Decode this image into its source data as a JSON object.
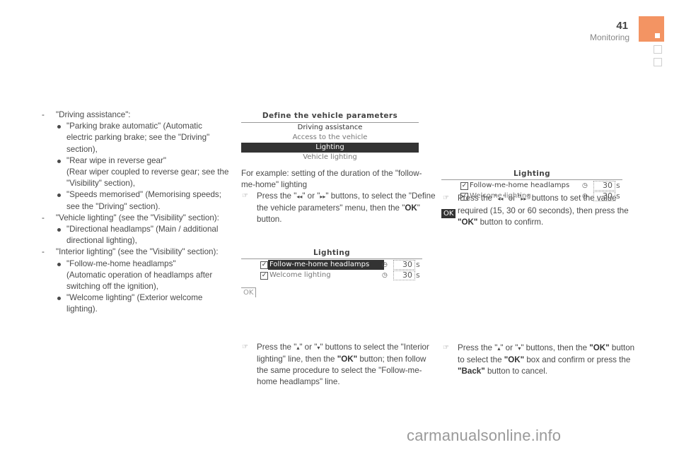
{
  "header": {
    "page_number": "41",
    "section": "Monitoring",
    "tab_color": "#f39463"
  },
  "column1": {
    "items": [
      {
        "marker": "-",
        "text": "\"Driving assistance\":",
        "bullets": [
          {
            "text": "\"Parking brake automatic\" (Automatic electric parking brake; see the \"Driving\" section),"
          },
          {
            "text": "\"Rear wipe in reverse gear\"",
            "sub": "(Rear wiper coupled to reverse gear; see the \"Visibility\" section),"
          },
          {
            "text": "\"Speeds memorised\" (Memorising speeds; see the \"Driving\" section)."
          }
        ]
      },
      {
        "marker": "-",
        "text": "\"Vehicle lighting\" (see the \"Visibility\" section):",
        "bullets": [
          {
            "text": "\"Directional headlamps\" (Main / additional directional lighting),"
          }
        ]
      },
      {
        "marker": "-",
        "text": "\"Interior lighting\" (see the \"Visibility\" section):",
        "bullets": [
          {
            "text": "\"Follow-me-home headlamps\"",
            "sub": "(Automatic operation of headlamps after switching off the ignition),"
          },
          {
            "text": "\"Welcome lighting\" (Exterior welcome lighting)."
          }
        ]
      }
    ]
  },
  "screen1": {
    "title": "Define the vehicle parameters",
    "lines": [
      {
        "label": "Driving assistance",
        "state": "dark"
      },
      {
        "label": "Access to the vehicle",
        "state": "light"
      },
      {
        "label": "Lighting",
        "state": "selected"
      },
      {
        "label": "Vehicle lighting",
        "state": "light"
      }
    ]
  },
  "column2": {
    "intro": "For example: setting of the duration of the \"follow-me-home\" lighting",
    "step1": {
      "pre": "Press the \"",
      "sym1": "◂◂",
      "mid": "\" or \"",
      "sym2": "▸▸",
      "post": "\" buttons, to select the \"Define the vehicle parameters\" menu, then the \"",
      "bold": "OK",
      "end": "\" button."
    },
    "step2": {
      "pre": "Press the \"",
      "sym1": "▴",
      "mid": "\" or \"",
      "sym2": "▾",
      "post": "\" buttons to select the \"Interior lighting\" line, then the ",
      "bold": "\"OK\"",
      "end": " button; then follow the same procedure to select the \"Follow-me-home headlamps\" line."
    }
  },
  "screen2": {
    "title": "Lighting",
    "rows": [
      {
        "label": "Follow-me-home headlamps",
        "checked": "✓",
        "value": "30",
        "unit": "s",
        "selected": true
      },
      {
        "label": "Welcome lighting",
        "checked": "✓",
        "value": "30",
        "unit": "s",
        "selected": false
      }
    ],
    "ok": "OK",
    "clock_icon": "◷"
  },
  "column3": {
    "step1": {
      "pre": "Press the \"",
      "sym1": "◂◂",
      "mid": "\" or \"",
      "sym2": "▸▸",
      "post": "\" buttons to set the value required (15, 30 or 60 seconds), then press the ",
      "bold": "\"OK\"",
      "end": " button to confirm."
    },
    "step2": {
      "pre": "Press the \"",
      "sym1": "▴",
      "mid": "\" or \"",
      "sym2": "▾",
      "post": "\" buttons, then the ",
      "bold1": "\"OK\"",
      "mid2": " button to select the ",
      "bold2": "\"OK\"",
      "mid3": " box and confirm or press the ",
      "bold3": "\"Back\"",
      "end": " button to cancel."
    }
  },
  "screen3": {
    "title": "Lighting",
    "rows": [
      {
        "label": "Follow-me-home headlamps",
        "checked": "✓",
        "value": "30",
        "unit": "s"
      },
      {
        "label": "Welcome lighting",
        "checked": "✓",
        "value": "30",
        "unit": "s"
      }
    ],
    "ok": "OK",
    "clock_icon": "◷"
  },
  "hand_icon": "☞",
  "watermark": "carmanualsonline.info"
}
